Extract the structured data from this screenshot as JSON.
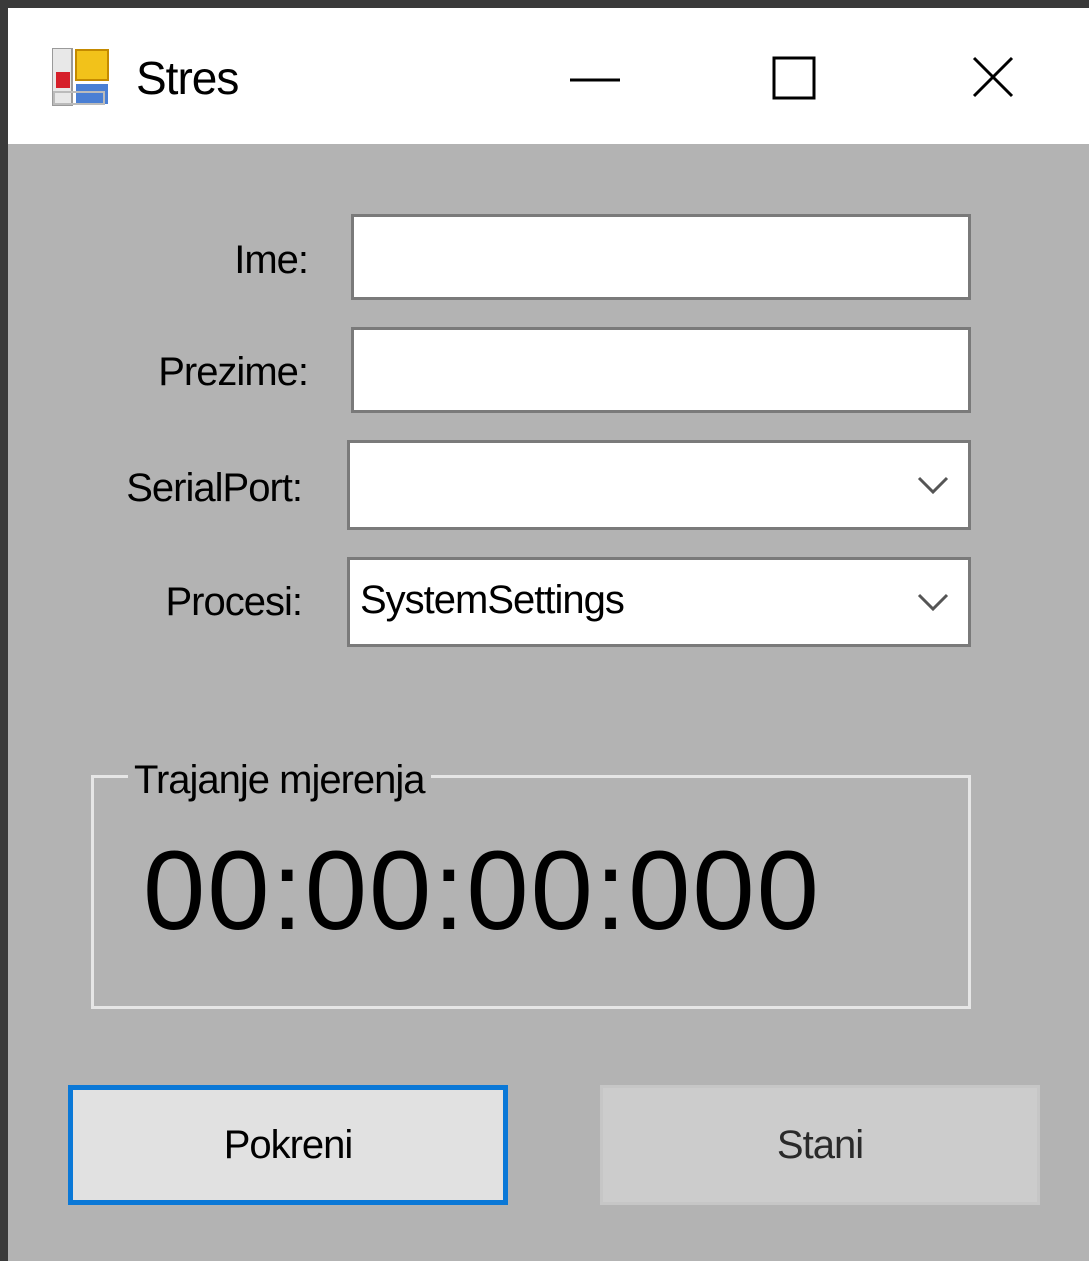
{
  "window": {
    "title": "Stres"
  },
  "form": {
    "ime_label": "Ime:",
    "ime_value": "",
    "prezime_label": "Prezime:",
    "prezime_value": "",
    "serialport_label": "SerialPort:",
    "serialport_value": "",
    "procesi_label": "Procesi:",
    "procesi_value": "SystemSettings"
  },
  "timer": {
    "group_title": "Trajanje mjerenja",
    "value": "00:00:00:000"
  },
  "buttons": {
    "start_label": "Pokreni",
    "stop_label": "Stani"
  },
  "colors": {
    "client_bg": "#b3b3b3",
    "focus_border": "#0a78d7"
  }
}
